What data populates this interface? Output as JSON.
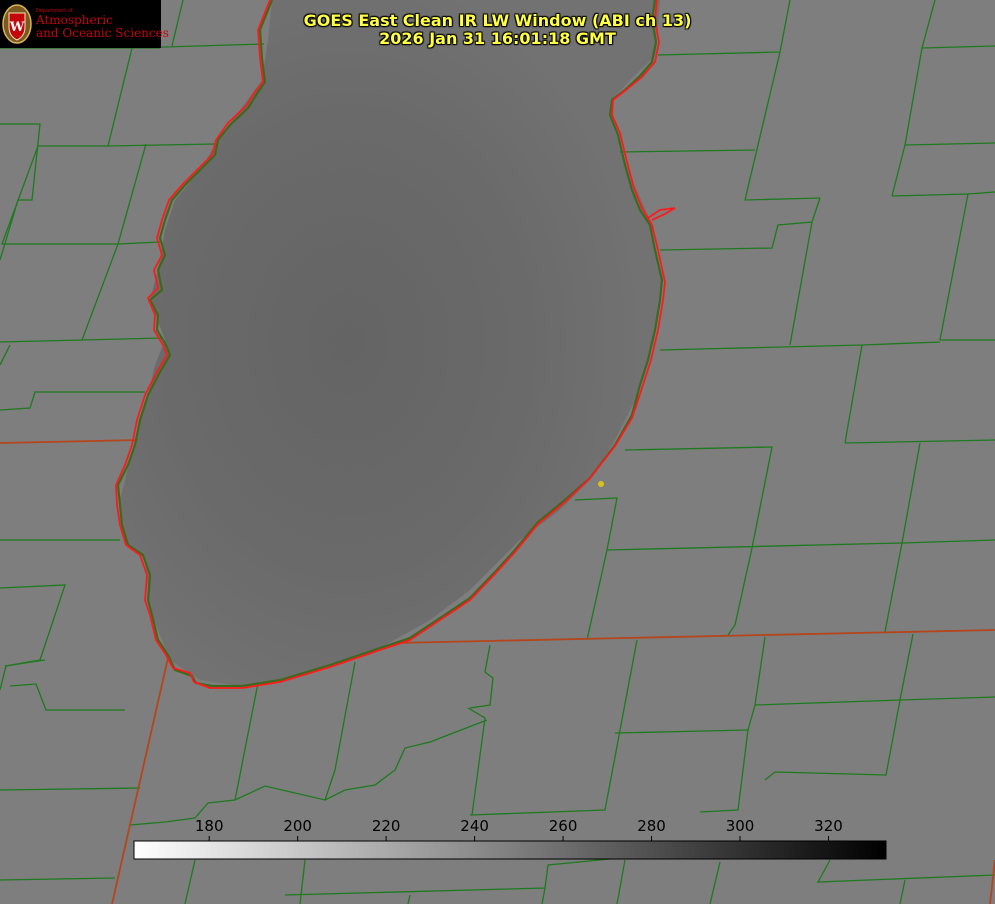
{
  "header": {
    "title_line1": "GOES East Clean IR LW Window (ABI ch 13)",
    "title_line2": "2026 Jan 31 16:01:18 GMT"
  },
  "logo": {
    "department": "Department of",
    "line1": "Atmospheric",
    "line2": "and Oceanic Sciences",
    "seal_letter": "W"
  },
  "colorbar": {
    "min_value": 163,
    "max_value": 333,
    "ticks": [
      "180",
      "200",
      "220",
      "240",
      "260",
      "280",
      "300",
      "320"
    ],
    "color_low": "#ffffff",
    "color_high": "#000000"
  },
  "colors": {
    "background": "#7e7e7e",
    "lake": "#6e6e6e",
    "lake_core": "#646464",
    "coastline": "#ff1a1a",
    "county_border": "#1e7a1e",
    "state_border": "#b5451b",
    "title_text": "#ffff44",
    "marker": "#d8c21a"
  }
}
